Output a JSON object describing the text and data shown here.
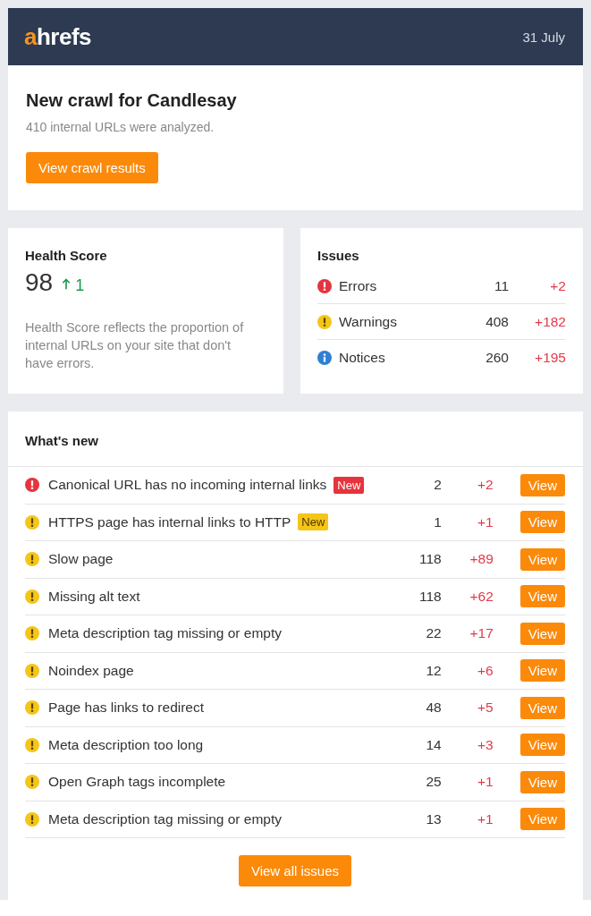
{
  "header": {
    "logo": "ahrefs",
    "date": "31 July"
  },
  "crawl": {
    "title": "New crawl for Candlesay",
    "subtitle": "410 internal URLs were analyzed.",
    "button": "View crawl results"
  },
  "health": {
    "title": "Health Score",
    "score": "98",
    "change": "1",
    "description": "Health Score reflects the proportion of internal URLs on your site that don't have errors."
  },
  "issues": {
    "title": "Issues",
    "rows": [
      {
        "kind": "error",
        "label": "Errors",
        "count": "11",
        "change": "+2"
      },
      {
        "kind": "warning",
        "label": "Warnings",
        "count": "408",
        "change": "+182"
      },
      {
        "kind": "notice",
        "label": "Notices",
        "count": "260",
        "change": "+195"
      }
    ]
  },
  "whats_new": {
    "title": "What's new",
    "rows": [
      {
        "kind": "error",
        "label": "Canonical URL has no incoming internal links",
        "badge": "New",
        "count": "2",
        "change": "+2",
        "button": "View"
      },
      {
        "kind": "warning",
        "label": "HTTPS page has internal links to HTTP",
        "badge": "New",
        "count": "1",
        "change": "+1",
        "button": "View"
      },
      {
        "kind": "warning",
        "label": "Slow page",
        "count": "118",
        "change": "+89",
        "button": "View"
      },
      {
        "kind": "warning",
        "label": "Missing alt text",
        "count": "118",
        "change": "+62",
        "button": "View"
      },
      {
        "kind": "warning",
        "label": "Meta description tag missing or empty",
        "count": "22",
        "change": "+17",
        "button": "View"
      },
      {
        "kind": "warning",
        "label": "Noindex page",
        "count": "12",
        "change": "+6",
        "button": "View"
      },
      {
        "kind": "warning",
        "label": "Page has links to redirect",
        "count": "48",
        "change": "+5",
        "button": "View"
      },
      {
        "kind": "warning",
        "label": "Meta description too long",
        "count": "14",
        "change": "+3",
        "button": "View"
      },
      {
        "kind": "warning",
        "label": "Open Graph tags incomplete",
        "count": "25",
        "change": "+1",
        "button": "View"
      },
      {
        "kind": "warning",
        "label": "Meta description tag missing or empty",
        "count": "13",
        "change": "+1",
        "button": "View"
      }
    ],
    "button": "View all issues"
  }
}
